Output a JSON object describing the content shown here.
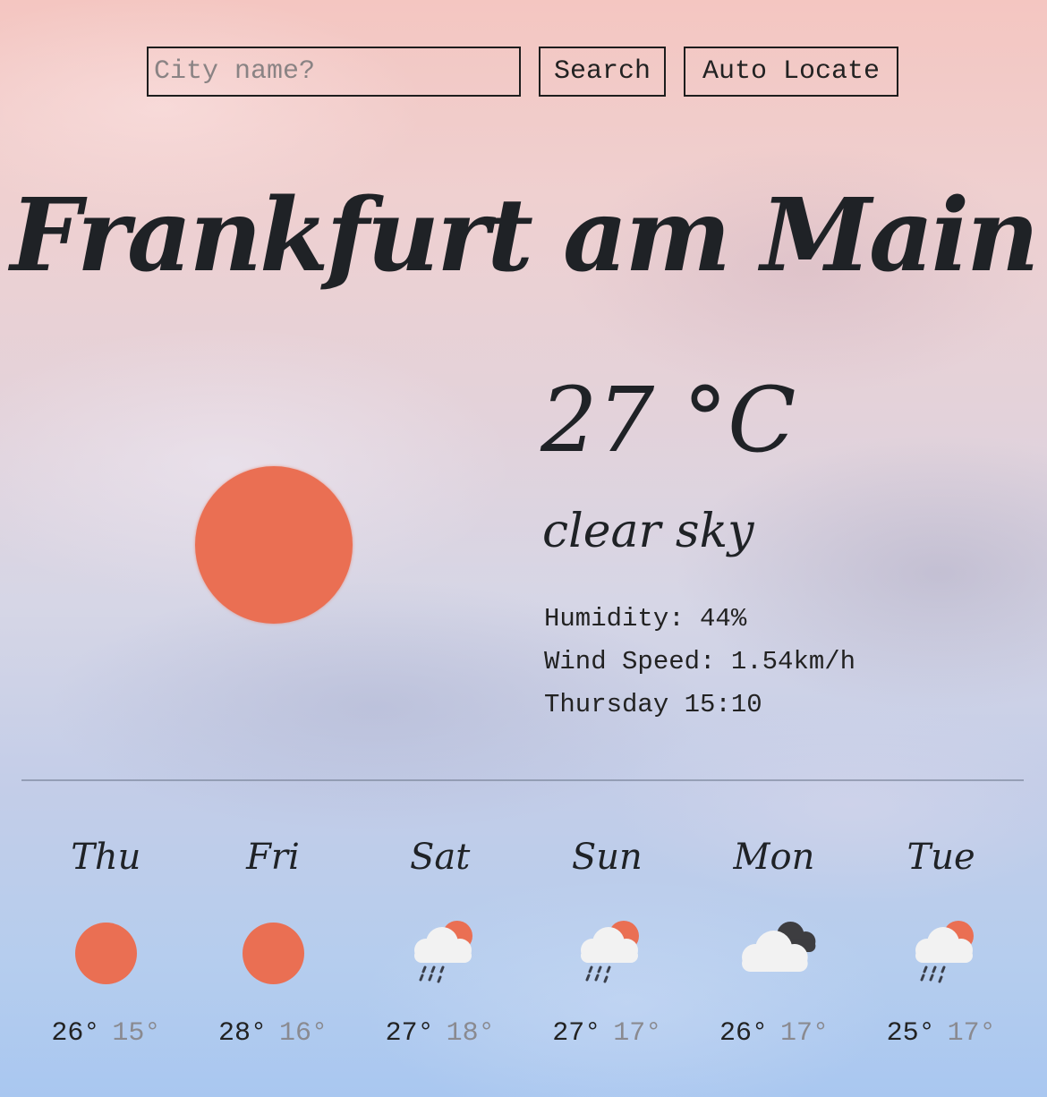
{
  "search": {
    "placeholder": "City name?",
    "search_label": "Search",
    "auto_locate_label": "Auto Locate"
  },
  "city": "Frankfurt am Main",
  "current": {
    "temperature": "27 °C",
    "description": "clear sky",
    "icon": "sun-icon",
    "humidity": "Humidity: 44%",
    "wind": "Wind Speed: 1.54km/h",
    "datetime": "Thursday 15:10"
  },
  "forecast": [
    {
      "day": "Thu",
      "icon": "sun-icon",
      "high": "26°",
      "low": "15°"
    },
    {
      "day": "Fri",
      "icon": "sun-icon",
      "high": "28°",
      "low": "16°"
    },
    {
      "day": "Sat",
      "icon": "rain-sun-cloud-icon",
      "high": "27°",
      "low": "18°"
    },
    {
      "day": "Sun",
      "icon": "rain-sun-cloud-icon",
      "high": "27°",
      "low": "17°"
    },
    {
      "day": "Mon",
      "icon": "cloudy-icon",
      "high": "26°",
      "low": "17°"
    },
    {
      "day": "Tue",
      "icon": "rain-sun-cloud-icon",
      "high": "25°",
      "low": "17°"
    }
  ],
  "colors": {
    "sun": "#ea6f53",
    "cloud_light": "#f2f2f2",
    "cloud_dark": "#3d3d40",
    "rain": "#3a3f4b",
    "text_dark": "#1f2226",
    "text_muted": "#8a8a90"
  }
}
